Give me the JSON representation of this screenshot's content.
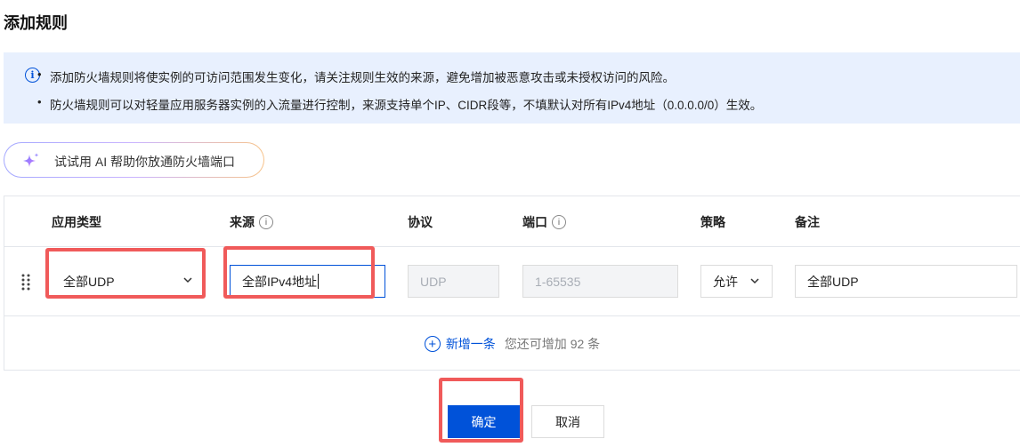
{
  "page": {
    "title": "添加规则"
  },
  "notice": {
    "lines": [
      "添加防火墙规则将使实例的可访问范围发生变化，请关注规则生效的来源，避免增加被恶意攻击或未授权访问的风险。",
      "防火墙规则可以对轻量应用服务器实例的入流量进行控制，来源支持单个IP、CIDR段等，不填默认对所有IPv4地址（0.0.0.0/0）生效。"
    ]
  },
  "ai_assistant": {
    "label": "试试用 AI 帮助你放通防火墙端口"
  },
  "table": {
    "headers": {
      "app_type": "应用类型",
      "source": "来源",
      "protocol": "协议",
      "port": "端口",
      "policy": "策略",
      "remark": "备注"
    },
    "row": {
      "app_type": "全部UDP",
      "source": "全部IPv4地址",
      "protocol": "UDP",
      "port": "1-65535",
      "policy": "允许",
      "remark": "全部UDP"
    },
    "add": {
      "label": "新增一条",
      "hint": "您还可增加 92 条"
    }
  },
  "actions": {
    "confirm": "确定",
    "cancel": "取消"
  },
  "colors": {
    "primary": "#0052d9",
    "highlight": "#f05a5a",
    "notice_bg": "#e8f0fe"
  }
}
